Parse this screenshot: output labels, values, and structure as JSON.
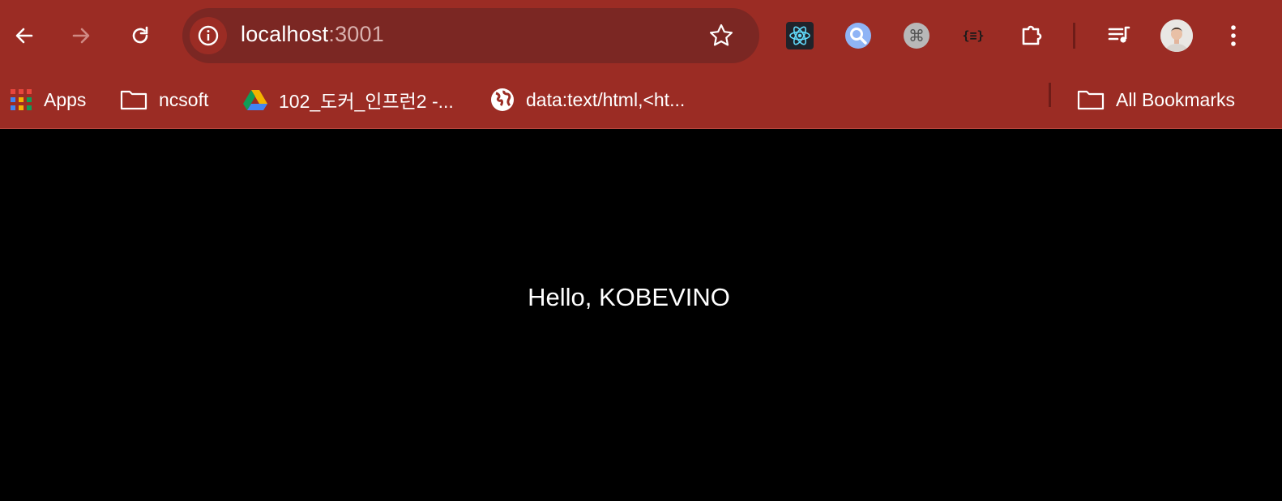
{
  "browser": {
    "url": {
      "host": "localhost",
      "port": ":3001"
    },
    "bookmarks": [
      {
        "label": "Apps",
        "icon": "apps-grid-icon"
      },
      {
        "label": "ncsoft",
        "icon": "folder-icon"
      },
      {
        "label": "102_도커_인프런2 -...",
        "icon": "google-drive-icon"
      },
      {
        "label": "data:text/html,<ht...",
        "icon": "globe-icon"
      }
    ],
    "all_bookmarks_label": "All Bookmarks",
    "extensions": [
      {
        "name": "react-devtools-icon"
      },
      {
        "name": "search-extension-icon"
      },
      {
        "name": "command-extension-icon"
      },
      {
        "name": "json-formatter-icon"
      },
      {
        "name": "extensions-puzzle-icon"
      }
    ],
    "json_ext_label": "{≡}",
    "cmd_ext_label": "⌘",
    "theme_color": "#9b2c24"
  },
  "page": {
    "message": "Hello, KOBEVINO"
  }
}
